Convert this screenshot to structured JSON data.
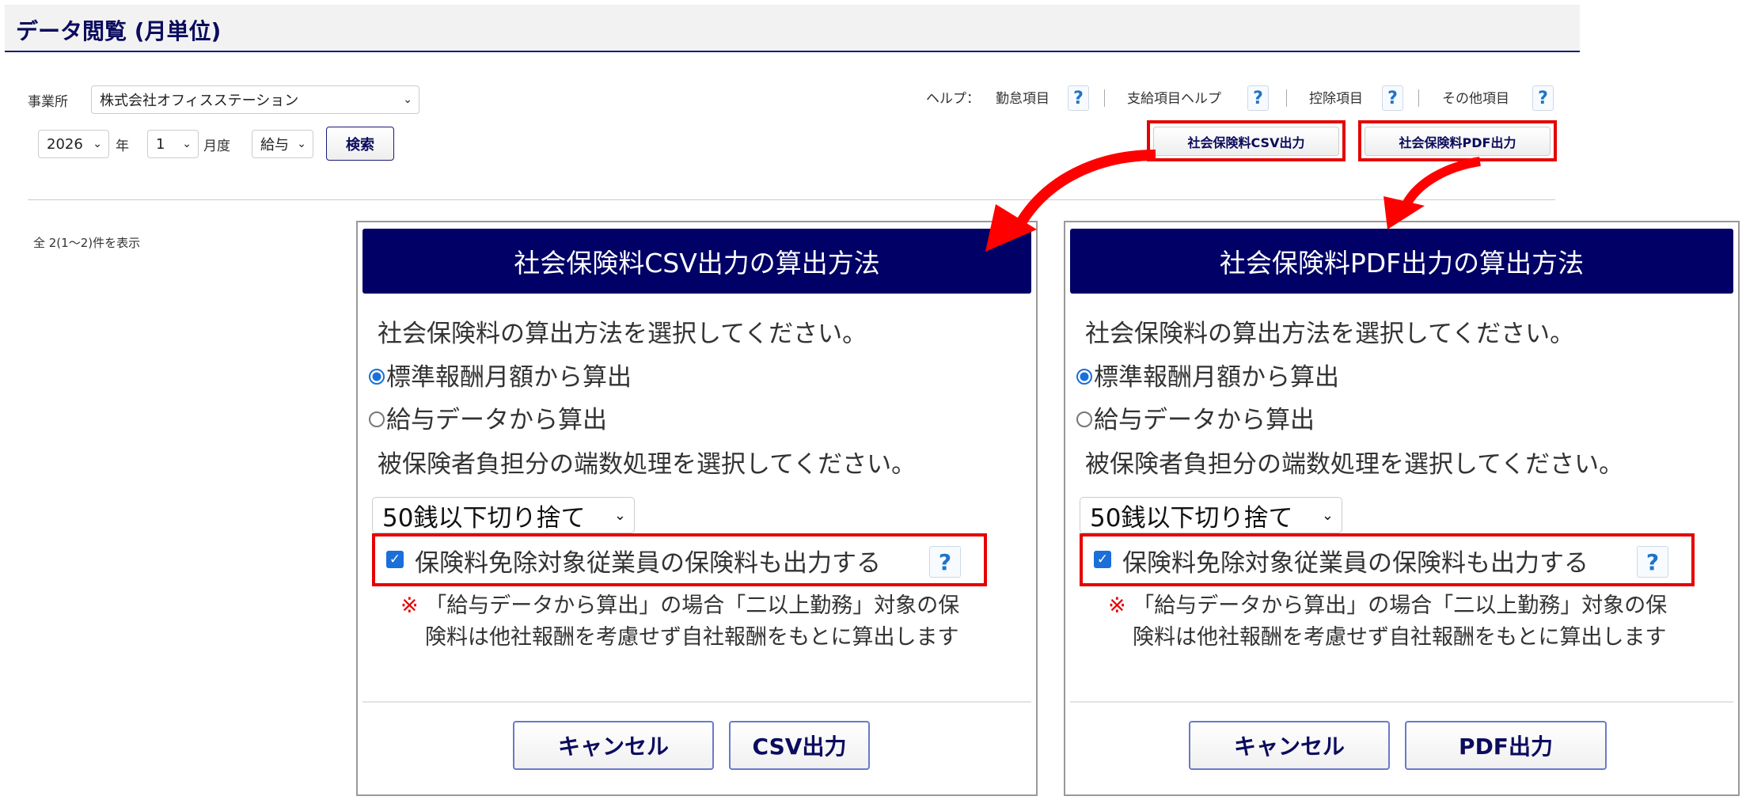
{
  "header": {
    "title": "データ閲覧 (月単位)"
  },
  "filters": {
    "office_label": "事業所",
    "office_value": "株式会社オフィスステーション",
    "year_value": "2026",
    "year_label": "年",
    "month_value": "1",
    "month_label": "月度",
    "type_value": "給与",
    "search_label": "検索"
  },
  "help": {
    "prefix": "ヘルプ：",
    "items": [
      "勤怠項目",
      "支給項目ヘルプ",
      "控除項目",
      "その他項目"
    ],
    "icon": "?"
  },
  "actions": {
    "csv_label": "社会保険料CSV出力",
    "pdf_label": "社会保険料PDF出力"
  },
  "result_count": "全 2(1〜2)件を表示",
  "dialogs": [
    {
      "title": "社会保険料CSV出力の算出方法",
      "prompt1": "社会保険料の算出方法を選択してください。",
      "radio1": "標準報酬月額から算出",
      "radio2": "給与データから算出",
      "prompt2": "被保険者負担分の端数処理を選択してください。",
      "rounding": "50銭以下切り捨て",
      "checkbox": "保険料免除対象従業員の保険料も出力する",
      "note_mark": "※",
      "note1": "「給与データから算出」の場合「二以上勤務」対象の保",
      "note2": "険料は他社報酬を考慮せず自社報酬をもとに算出します",
      "cancel": "キャンセル",
      "submit": "CSV出力"
    },
    {
      "title": "社会保険料PDF出力の算出方法",
      "prompt1": "社会保険料の算出方法を選択してください。",
      "radio1": "標準報酬月額から算出",
      "radio2": "給与データから算出",
      "prompt2": "被保険者負担分の端数処理を選択してください。",
      "rounding": "50銭以下切り捨て",
      "checkbox": "保険料免除対象従業員の保険料も出力する",
      "note_mark": "※",
      "note1": "「給与データから算出」の場合「二以上勤務」対象の保",
      "note2": "険料は他社報酬を考慮せず自社報酬をもとに算出します",
      "cancel": "キャンセル",
      "submit": "PDF出力"
    }
  ],
  "colors": {
    "navy": "#000066",
    "highlight": "#e60000",
    "accent": "#1a6fd8"
  }
}
